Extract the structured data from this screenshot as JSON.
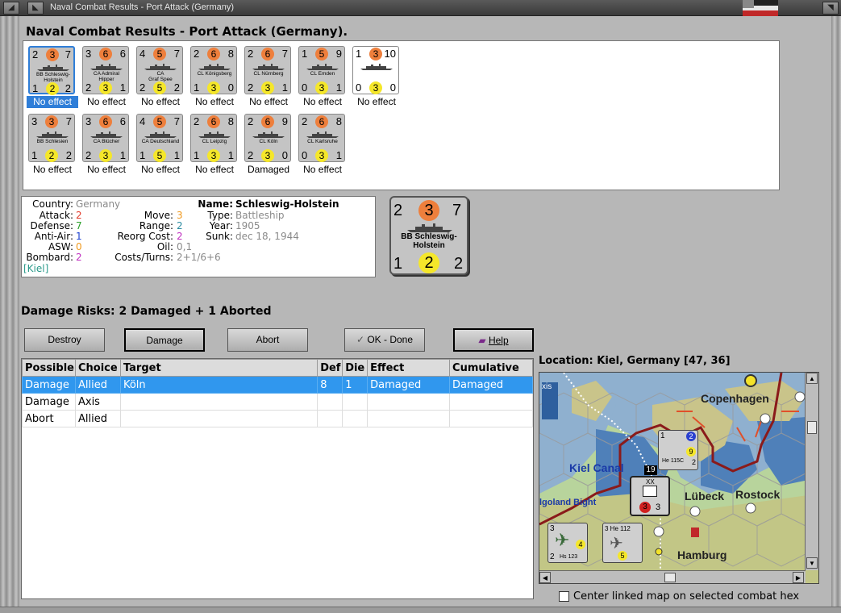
{
  "window": {
    "title": "Naval Combat Results - Port Attack (Germany)"
  },
  "header": "Naval Combat Results - Port Attack (Germany).",
  "units": [
    {
      "top": "2",
      "att": "3",
      "right": "7",
      "name": [
        "BB Schleswig-",
        "Holstein"
      ],
      "b1": "1",
      "b2": "2",
      "b3": "2",
      "effect": "No effect",
      "selected": true
    },
    {
      "top": "3",
      "att": "6",
      "right": "6",
      "name": [
        "CA Admiral",
        "Hipper"
      ],
      "b1": "2",
      "b2": "3",
      "b3": "1",
      "effect": "No effect"
    },
    {
      "top": "4",
      "att": "5",
      "right": "7",
      "name": [
        "CA",
        "Graf Spee"
      ],
      "b1": "2",
      "b2": "5",
      "b3": "2",
      "effect": "No effect"
    },
    {
      "top": "2",
      "att": "6",
      "right": "8",
      "name": [
        "CL Königsberg"
      ],
      "b1": "1",
      "b2": "3",
      "b3": "0",
      "effect": "No effect"
    },
    {
      "top": "2",
      "att": "6",
      "right": "7",
      "name": [
        "CL Nürnberg"
      ],
      "b1": "2",
      "b2": "3",
      "b3": "1",
      "effect": "No effect"
    },
    {
      "top": "1",
      "att": "5",
      "right": "9",
      "name": [
        "CL Emden"
      ],
      "b1": "0",
      "b2": "3",
      "b3": "1",
      "effect": "No effect"
    },
    {
      "top": "1",
      "att": "3",
      "right": "10",
      "name": [],
      "b1": "0",
      "b2": "3",
      "b3": "0",
      "effect": "No effect",
      "white": true
    },
    {
      "top": "3",
      "att": "3",
      "right": "7",
      "name": [
        "BB Schlesien"
      ],
      "b1": "1",
      "b2": "2",
      "b3": "2",
      "effect": "No effect"
    },
    {
      "top": "3",
      "att": "6",
      "right": "6",
      "name": [
        "CA Blücher"
      ],
      "b1": "2",
      "b2": "3",
      "b3": "1",
      "effect": "No effect"
    },
    {
      "top": "4",
      "att": "5",
      "right": "7",
      "name": [
        "CA Deutschland"
      ],
      "b1": "1",
      "b2": "5",
      "b3": "1",
      "effect": "No effect"
    },
    {
      "top": "2",
      "att": "6",
      "right": "8",
      "name": [
        "CL Leipzig"
      ],
      "b1": "1",
      "b2": "3",
      "b3": "1",
      "effect": "No effect"
    },
    {
      "top": "2",
      "att": "6",
      "right": "9",
      "name": [
        "CL Köln"
      ],
      "b1": "2",
      "b2": "3",
      "b3": "0",
      "effect": "Damaged"
    },
    {
      "top": "2",
      "att": "6",
      "right": "8",
      "name": [
        "CL Karlsruhe"
      ],
      "b1": "0",
      "b2": "3",
      "b3": "1",
      "effect": "No effect"
    }
  ],
  "info": {
    "country_label": "Country:",
    "country": "Germany",
    "attack_label": "Attack:",
    "attack": "2",
    "defense_label": "Defense:",
    "defense": "7",
    "antiair_label": "Anti-Air:",
    "antiair": "1",
    "asw_label": "ASW:",
    "asw": "0",
    "bombard_label": "Bombard:",
    "bombard": "2",
    "location": "[Kiel]",
    "move_label": "Move:",
    "move": "3",
    "range_label": "Range:",
    "range": "2",
    "reorg_label": "Reorg Cost:",
    "reorg": "2",
    "oil_label": "Oil:",
    "oil": "0,1",
    "costs_label": "Costs/Turns:",
    "costs": "2+1/6+6",
    "name_label": "Name:",
    "name": "Schleswig-Holstein",
    "type_label": "Type:",
    "type": "Battleship",
    "year_label": "Year:",
    "year": "1905",
    "sunk_label": "Sunk:",
    "sunk": "dec 18, 1944",
    "colors": {
      "attack": "#e23a2a",
      "defense": "#2aa02a",
      "antiair": "#1a40d0",
      "asw": "#f09a20",
      "bombard": "#c030c0",
      "gray": "#8a8a8a",
      "loc": "#2a9a8a"
    }
  },
  "big_counter": {
    "top": "2",
    "att": "3",
    "right": "7",
    "name1": "BB Schleswig-",
    "name2": "Holstein",
    "b1": "1",
    "b2": "2",
    "b3": "2"
  },
  "damage_risks": "Damage Risks: 2 Damaged + 1 Aborted",
  "buttons": {
    "destroy": "Destroy",
    "damage": "Damage",
    "abort": "Abort",
    "ok": "OK - Done",
    "help": "Help"
  },
  "table": {
    "headers": [
      "Possible",
      "Choice",
      "Target",
      "Def",
      "Die",
      "Effect",
      "Cumulative"
    ],
    "rows": [
      [
        "Damage",
        "Allied",
        "Köln",
        "8",
        "1",
        "Damaged",
        "Damaged"
      ],
      [
        "Damage",
        "Axis",
        "",
        "",
        "",
        "",
        ""
      ],
      [
        "Abort",
        "Allied",
        "",
        "",
        "",
        "",
        ""
      ]
    ]
  },
  "map": {
    "location_label": "Location:  Kiel, Germany [47, 36]",
    "labels": {
      "copenhagen": "Copenhagen",
      "kiel_canal": "Kiel Canal",
      "lubeck": "Lübeck",
      "rostock": "Rostock",
      "heligoland": "lgoland Bight",
      "hamburg": "Hamburg",
      "ixis": "xis"
    },
    "counters": {
      "he115": "He 115C",
      "he115_top": "1",
      "he115_a": "2",
      "he115_b": "9",
      "he115_c": "2",
      "army_num": "19",
      "army_a": "3",
      "army_b": "3",
      "army_xx": "XX",
      "he112": "3 He 112",
      "he112_b": "5",
      "hs123": "Hs 123",
      "hs123_a": "2",
      "hs123_b": "4",
      "hs123_top": "3"
    }
  },
  "center_checkbox": "Center linked map on selected combat hex"
}
